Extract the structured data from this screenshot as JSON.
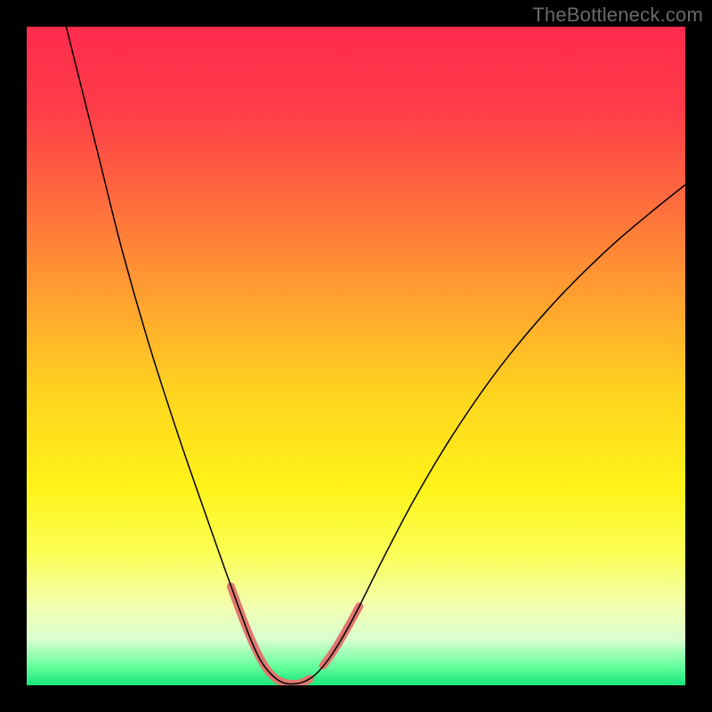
{
  "watermark": "TheBottleneck.com",
  "chart_data": {
    "type": "line",
    "title": "",
    "xlabel": "",
    "ylabel": "",
    "xlim": [
      0,
      100
    ],
    "ylim": [
      0,
      100
    ],
    "background_gradient": {
      "stops": [
        {
          "offset": 0.0,
          "color": "#ff2b4d"
        },
        {
          "offset": 0.12,
          "color": "#ff3b4a"
        },
        {
          "offset": 0.26,
          "color": "#ff6a3e"
        },
        {
          "offset": 0.42,
          "color": "#ffa42f"
        },
        {
          "offset": 0.56,
          "color": "#ffd51f"
        },
        {
          "offset": 0.7,
          "color": "#fff319"
        },
        {
          "offset": 0.8,
          "color": "#fbff55"
        },
        {
          "offset": 0.88,
          "color": "#f3ffb0"
        },
        {
          "offset": 0.93,
          "color": "#d9ffcf"
        },
        {
          "offset": 0.97,
          "color": "#6aff9e"
        },
        {
          "offset": 1.0,
          "color": "#17e67d"
        }
      ]
    },
    "series": [
      {
        "name": "curve",
        "color": "#000000",
        "width": 1.5,
        "points": [
          {
            "x": 6.0,
            "y": 100.0
          },
          {
            "x": 8.0,
            "y": 92.0
          },
          {
            "x": 11.0,
            "y": 80.0
          },
          {
            "x": 14.5,
            "y": 66.0
          },
          {
            "x": 18.5,
            "y": 52.0
          },
          {
            "x": 23.0,
            "y": 38.0
          },
          {
            "x": 27.5,
            "y": 25.0
          },
          {
            "x": 30.5,
            "y": 16.5
          },
          {
            "x": 32.5,
            "y": 11.0
          },
          {
            "x": 34.0,
            "y": 7.0
          },
          {
            "x": 35.5,
            "y": 3.8
          },
          {
            "x": 37.0,
            "y": 1.8
          },
          {
            "x": 38.5,
            "y": 0.6
          },
          {
            "x": 40.0,
            "y": 0.2
          },
          {
            "x": 42.0,
            "y": 0.5
          },
          {
            "x": 43.8,
            "y": 1.6
          },
          {
            "x": 45.5,
            "y": 3.5
          },
          {
            "x": 47.5,
            "y": 6.5
          },
          {
            "x": 50.0,
            "y": 11.0
          },
          {
            "x": 54.0,
            "y": 19.0
          },
          {
            "x": 59.0,
            "y": 28.5
          },
          {
            "x": 65.0,
            "y": 38.5
          },
          {
            "x": 72.0,
            "y": 48.5
          },
          {
            "x": 80.0,
            "y": 58.0
          },
          {
            "x": 88.0,
            "y": 66.0
          },
          {
            "x": 95.0,
            "y": 72.0
          },
          {
            "x": 100.0,
            "y": 76.0
          }
        ]
      }
    ],
    "highlights": [
      {
        "name": "left-highlight",
        "color": "#e0776e",
        "width": 9,
        "points": [
          {
            "x": 31.0,
            "y": 15.0
          },
          {
            "x": 33.0,
            "y": 9.6
          },
          {
            "x": 34.8,
            "y": 5.4
          },
          {
            "x": 36.5,
            "y": 2.4
          },
          {
            "x": 38.0,
            "y": 0.9
          },
          {
            "x": 39.5,
            "y": 0.3
          },
          {
            "x": 41.5,
            "y": 0.3
          },
          {
            "x": 43.0,
            "y": 1.0
          }
        ]
      },
      {
        "name": "right-highlight",
        "color": "#e0776e",
        "width": 9,
        "points": [
          {
            "x": 45.0,
            "y": 3.0
          },
          {
            "x": 46.6,
            "y": 5.2
          },
          {
            "x": 48.4,
            "y": 8.2
          },
          {
            "x": 50.5,
            "y": 12.0
          }
        ]
      }
    ]
  }
}
